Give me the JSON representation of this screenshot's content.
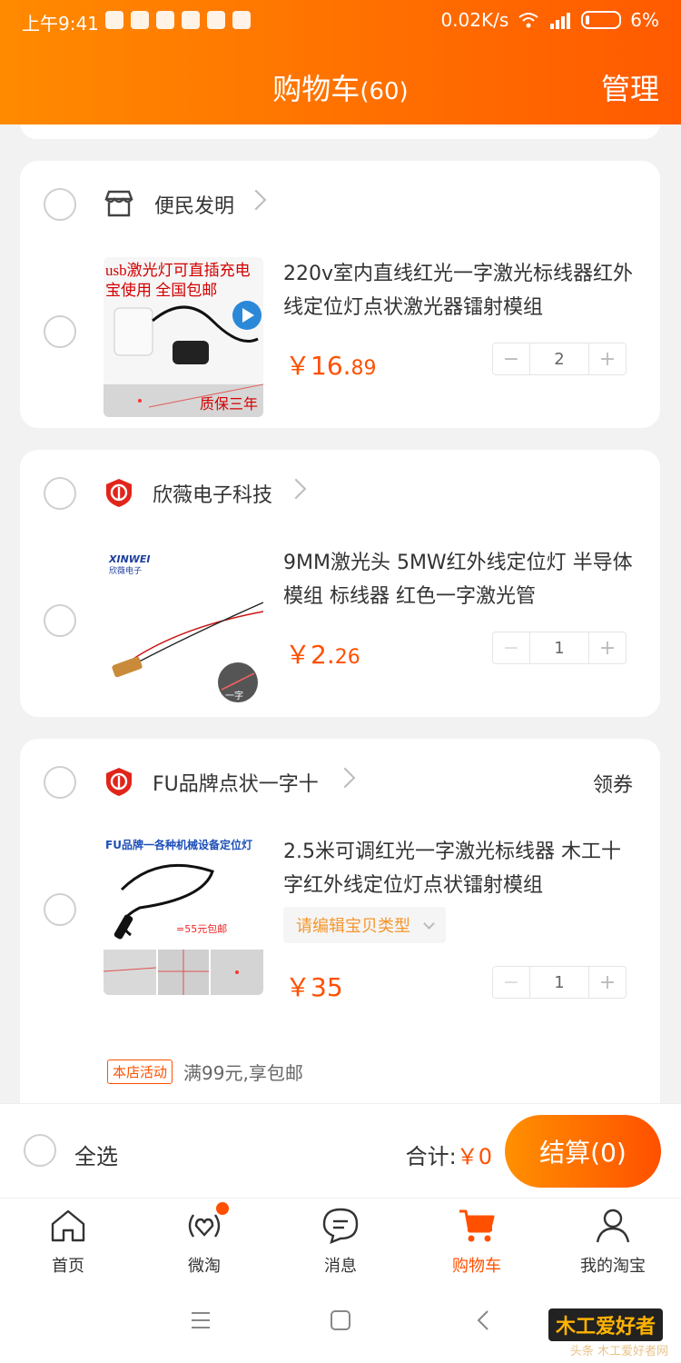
{
  "status_bar": {
    "time": "上午9:41",
    "net_speed": "0.02K/s",
    "battery": "6%"
  },
  "header": {
    "title": "购物车",
    "count": "(60)",
    "manage_label": "管理"
  },
  "shops": [
    {
      "name": "便民发明",
      "coupon": "",
      "items": [
        {
          "title": "220v室内直线红光一字激光标线器红外线定位灯点状激光器镭射模组",
          "price_yen": "￥16.",
          "price_cents": "89",
          "qty": "2",
          "thumb_caption_top": "usb激光灯可直插充电宝使用 全国包邮",
          "thumb_caption_bottom": "质保三年"
        }
      ]
    },
    {
      "name": "欣薇电子科技",
      "coupon": "",
      "items": [
        {
          "title": "9MM激光头 5MW红外线定位灯 半导体模组 标线器 红色一字激光管",
          "price_yen": "￥2.",
          "price_cents": "26",
          "qty": "1",
          "thumb_brand": "XINWEI",
          "thumb_brand_cn": "欣薇电子",
          "thumb_badge": "一字"
        }
      ]
    },
    {
      "name": "FU品牌点状一字十",
      "coupon": "领券",
      "items": [
        {
          "title": "2.5米可调红光一字激光标线器 木工十字红外线定位灯点状镭射模组",
          "sku_placeholder": "请编辑宝贝类型",
          "price_yen": "￥35",
          "price_cents": "",
          "qty": "1",
          "thumb_caption_top": "FU品牌一各种机械设备定位灯",
          "thumb_caption_mid": "=55元包邮"
        }
      ],
      "promo_tag": "本店活动",
      "promo_text": "满99元,享包邮"
    }
  ],
  "footer": {
    "select_all": "全选",
    "total_label": "合计:",
    "total_amount": "￥0",
    "checkout_label": "结算(0)"
  },
  "tabs": [
    {
      "label": "首页",
      "icon": "home-icon"
    },
    {
      "label": "微淘",
      "icon": "weitao-icon"
    },
    {
      "label": "消息",
      "icon": "message-icon"
    },
    {
      "label": "购物车",
      "icon": "cart-icon"
    },
    {
      "label": "我的淘宝",
      "icon": "profile-icon"
    }
  ],
  "watermark": {
    "logo": "木工爱好者",
    "sub": "头条 木工爱好者网"
  },
  "colors": {
    "accent": "#ff5000",
    "header_start": "#ff8a00",
    "header_end": "#ff5a00"
  }
}
